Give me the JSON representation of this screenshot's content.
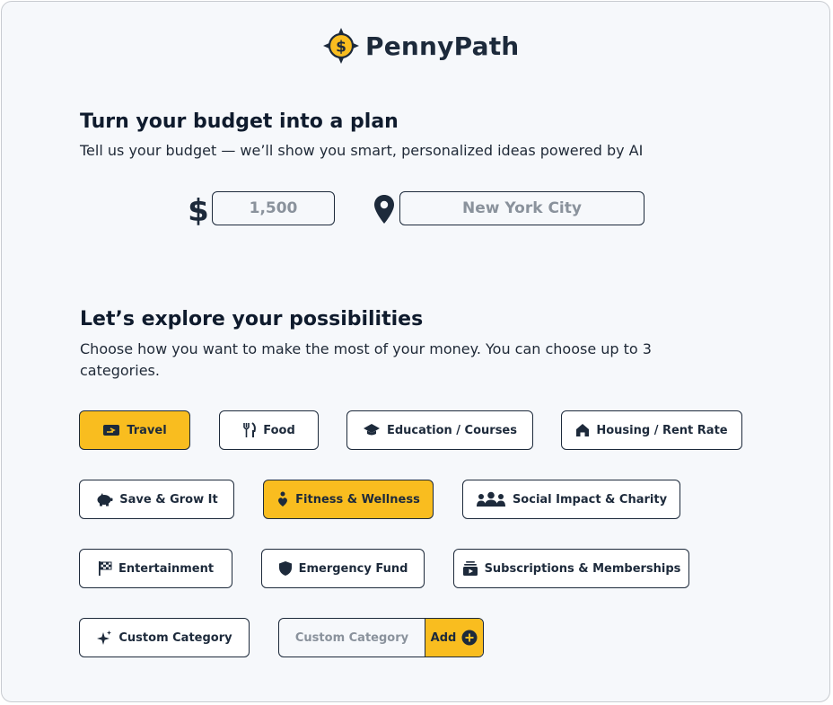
{
  "brand": {
    "name": "PennyPath"
  },
  "budget_section": {
    "title": "Turn your budget into a plan",
    "subtitle": "Tell us your budget — we’ll show you smart, personalized ideas powered by AI",
    "amount_placeholder": "1,500",
    "location_placeholder": "New York City"
  },
  "categories_section": {
    "title": "Let’s explore your possibilities",
    "subtitle_line1": "Choose how you want to make the most of your money. You can choose up to 3",
    "subtitle_line2": "categories."
  },
  "categories": [
    {
      "label": "Travel",
      "icon": "ticket-icon",
      "selected": true
    },
    {
      "label": "Food",
      "icon": "fork-knife-icon",
      "selected": false
    },
    {
      "label": "Education / Courses",
      "icon": "graduation-cap-icon",
      "selected": false
    },
    {
      "label": "Housing / Rent Rate",
      "icon": "house-icon",
      "selected": false
    },
    {
      "label": "Save & Grow It",
      "icon": "piggy-bank-icon",
      "selected": false
    },
    {
      "label": "Fitness & Wellness",
      "icon": "person-heart-icon",
      "selected": true
    },
    {
      "label": "Social Impact & Charity",
      "icon": "people-group-icon",
      "selected": false
    },
    {
      "label": "Entertainment",
      "icon": "checkered-flag-icon",
      "selected": false
    },
    {
      "label": "Emergency Fund",
      "icon": "shield-icon",
      "selected": false
    },
    {
      "label": "Subscriptions & Memberships",
      "icon": "play-stack-icon",
      "selected": false
    },
    {
      "label": "Custom Category",
      "icon": "sparkles-icon",
      "selected": false
    }
  ],
  "custom_category": {
    "placeholder": "Custom Category",
    "add_label": "Add"
  },
  "colors": {
    "accent": "#f9bd1f",
    "ink": "#1d2a3b",
    "background": "#f6f8fb",
    "placeholder": "#8a929c"
  }
}
